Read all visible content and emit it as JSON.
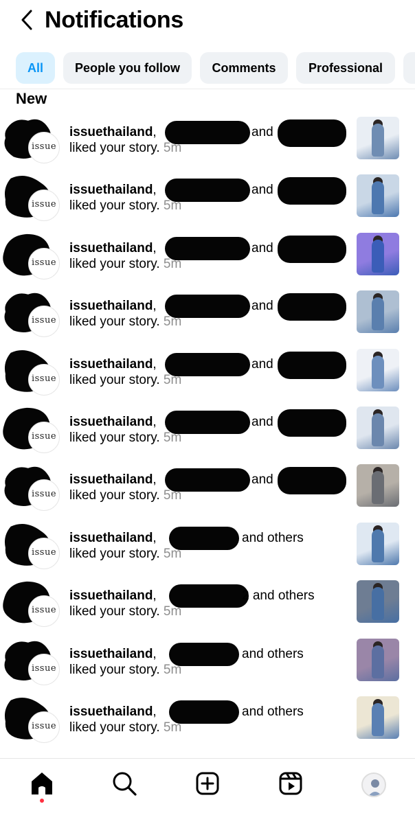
{
  "header": {
    "title": "Notifications",
    "back_icon": "chevron-left-icon"
  },
  "filters": [
    {
      "label": "All",
      "active": true
    },
    {
      "label": "People you follow",
      "active": false
    },
    {
      "label": "Comments",
      "active": false
    },
    {
      "label": "Professional",
      "active": false
    }
  ],
  "section": {
    "title": "New"
  },
  "notifications": [
    {
      "username": "issuethailand",
      "connector": "and",
      "suffix": "",
      "action": "liked your story.",
      "time": "5m",
      "avatar_text": "issue",
      "thumb_colors": [
        "#e9eef4",
        "#6f8db3"
      ]
    },
    {
      "username": "issuethailand",
      "connector": "and",
      "suffix": "",
      "action": "liked your story.",
      "time": "5m",
      "avatar_text": "issue",
      "thumb_colors": [
        "#c9d7e6",
        "#4d78b0"
      ]
    },
    {
      "username": "issuethailand",
      "connector": "and",
      "suffix": "",
      "action": "liked your story.",
      "time": "5m",
      "avatar_text": "issue",
      "thumb_colors": [
        "#8f7ce0",
        "#3b5db8"
      ]
    },
    {
      "username": "issuethailand",
      "connector": "and",
      "suffix": "",
      "action": "liked your story.",
      "time": "5m",
      "avatar_text": "issue",
      "thumb_colors": [
        "#aebfd2",
        "#5a7fae"
      ]
    },
    {
      "username": "issuethailand",
      "connector": "and",
      "suffix": "",
      "action": "liked your story.",
      "time": "5m",
      "avatar_text": "issue",
      "thumb_colors": [
        "#eef1f6",
        "#6d8fbd"
      ]
    },
    {
      "username": "issuethailand",
      "connector": "and",
      "suffix": "",
      "action": "liked your story.",
      "time": "5m",
      "avatar_text": "issue",
      "thumb_colors": [
        "#dfe6ef",
        "#6b87ad"
      ]
    },
    {
      "username": "issuethailand",
      "connector": "and",
      "suffix": "",
      "action": "liked your story.",
      "time": "5m",
      "avatar_text": "issue",
      "thumb_colors": [
        "#b6b0a8",
        "#6a6d73"
      ]
    },
    {
      "username": "issuethailand",
      "connector": "",
      "suffix": "and others",
      "action": "liked your story.",
      "time": "5m",
      "avatar_text": "issue",
      "thumb_colors": [
        "#dfe8f2",
        "#4f79ad"
      ]
    },
    {
      "username": "issuethailand",
      "connector": "",
      "suffix": "2 and others",
      "action": "liked your story.",
      "time": "5m",
      "avatar_text": "issue",
      "thumb_colors": [
        "#6e7d93",
        "#476fa3"
      ]
    },
    {
      "username": "issuethailand",
      "connector": "",
      "suffix": "and others",
      "action": "liked your story.",
      "time": "5m",
      "avatar_text": "issue",
      "thumb_colors": [
        "#9a86a8",
        "#5c6fa1"
      ]
    },
    {
      "username": "issuethailand",
      "connector": "",
      "suffix": "and others",
      "action": "liked your story.",
      "time": "5m",
      "avatar_text": "issue",
      "thumb_colors": [
        "#ece6d4",
        "#5a80b3"
      ]
    }
  ],
  "nav": {
    "items": [
      "home-icon",
      "search-icon",
      "create-icon",
      "reels-icon",
      "profile-avatar"
    ],
    "active": "home-icon",
    "notification_dot_color": "#ff3040"
  },
  "colors": {
    "accent": "#0a95f6",
    "chip_active_bg": "#dbf1fe",
    "chip_bg": "#eff2f5",
    "muted": "#8e8e8e"
  }
}
